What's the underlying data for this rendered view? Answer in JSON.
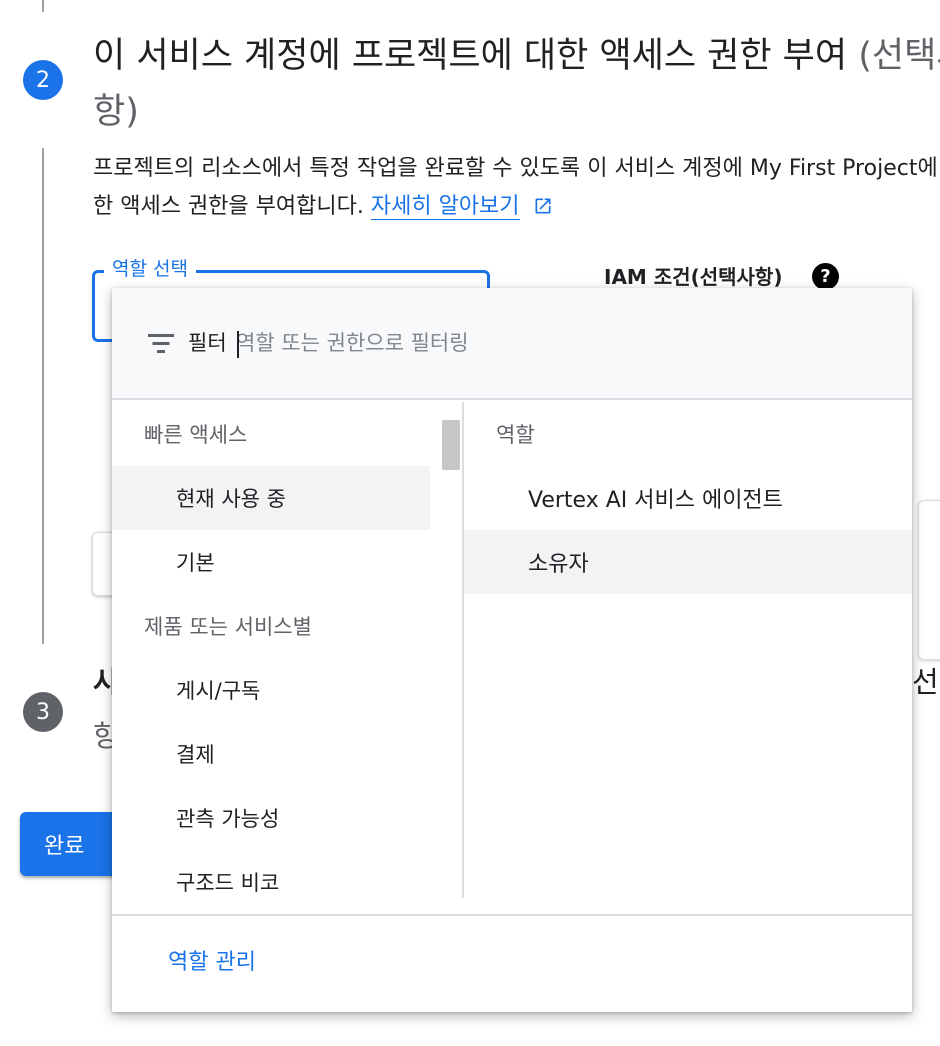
{
  "step2": {
    "number": "2",
    "title": "이 서비스 계정에 프로젝트에 대한 액세스 권한 부여",
    "title_optional": "(선택사항)",
    "description": "프로젝트의 리소스에서 특정 작업을 완료할 수 있도록 이 서비스 계정에 My First Project에 대한 액세스 권한을 부여합니다.",
    "learn_more_link": "자세히 알아보기",
    "role_field_label": "역할 선택",
    "iam_condition_label": "IAM 조건(선택사항)",
    "help_icon_glyph": "?"
  },
  "step3": {
    "number": "3",
    "title": "사용자에게 이 서비스 계정에 대한 액세스 권한 부여",
    "title_optional": "(선택사항)",
    "visible_title_start": "사",
    "visible_title_end": "선",
    "visible_sub": "항"
  },
  "done_button": "완료",
  "role_dropdown": {
    "filter_label": "필터",
    "filter_placeholder": "역할 또는 권한으로 필터링",
    "left_column": {
      "quick_access_header": "빠른 액세스",
      "quick_access_items": [
        {
          "label": "현재 사용 중",
          "active": true
        },
        {
          "label": "기본",
          "active": false
        }
      ],
      "by_product_header": "제품 또는 서비스별",
      "by_product_items": [
        {
          "label": "게시/구독"
        },
        {
          "label": "결제"
        },
        {
          "label": "관측 가능성"
        },
        {
          "label": "구조드 비코"
        }
      ]
    },
    "right_column": {
      "header": "역할",
      "items": [
        {
          "label": "Vertex AI 서비스 에이전트",
          "hover": false
        },
        {
          "label": "소유자",
          "hover": true
        }
      ]
    },
    "manage_roles_link": "역할 관리"
  },
  "colors": {
    "accent": "#1a73e8",
    "step_inactive": "#5f6368",
    "text_secondary": "#5f6368",
    "selected_bg": "#f1f3f4"
  },
  "icons": [
    "filter-icon",
    "open-in-new-icon",
    "help-icon"
  ]
}
